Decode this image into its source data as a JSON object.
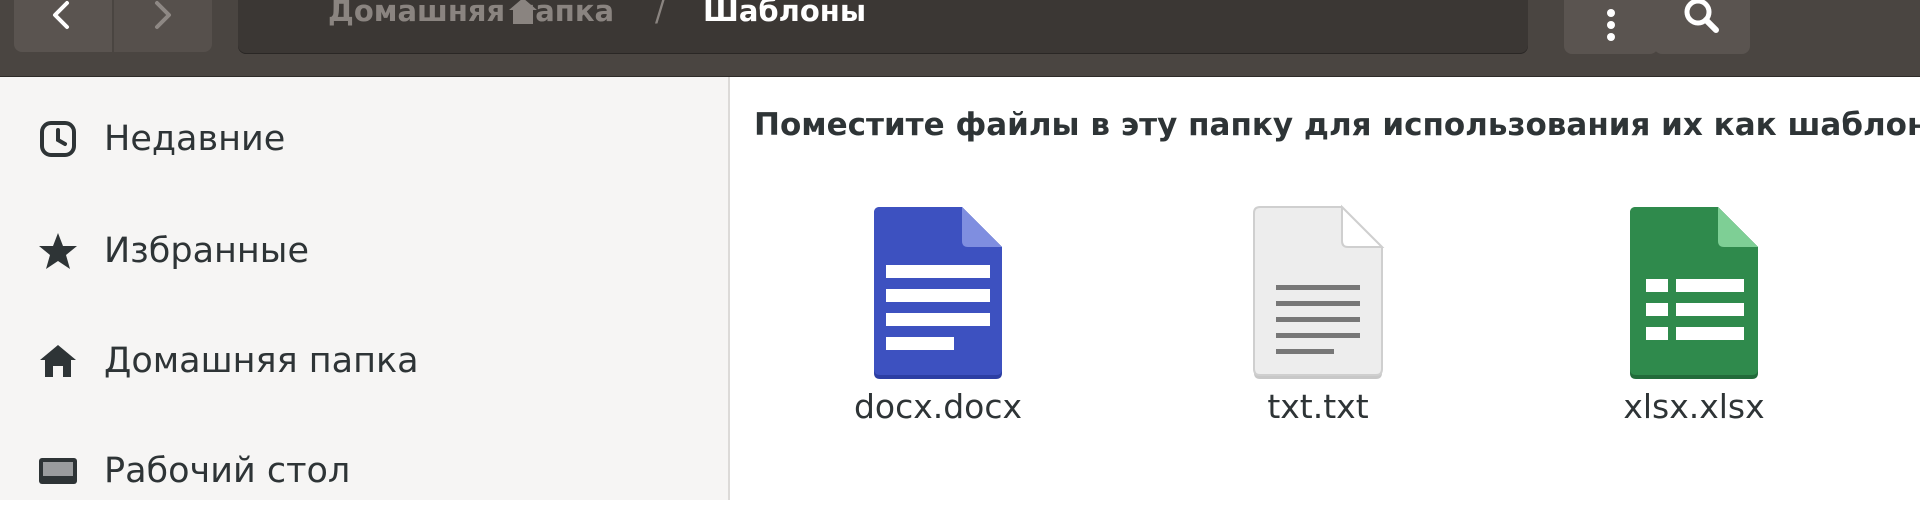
{
  "header": {
    "back_icon": "chevron-left-icon",
    "forward_icon": "chevron-right-icon",
    "breadcrumb": {
      "home_label": "Домашняя папка",
      "separator": "/",
      "current_label": "Шаблоны"
    },
    "menu_icon": "vertical-dots-icon",
    "search_icon": "search-icon"
  },
  "sidebar": {
    "items": [
      {
        "label": "Недавние",
        "icon": "clock-icon"
      },
      {
        "label": "Избранные",
        "icon": "star-icon"
      },
      {
        "label": "Домашняя папка",
        "icon": "home-icon"
      },
      {
        "label": "Рабочий стол",
        "icon": "desktop-icon"
      }
    ]
  },
  "main": {
    "hint_text": "Поместите файлы в эту папку для использования их как шаблон",
    "files": [
      {
        "name": "docx.docx",
        "icon": "document-icon",
        "color": "#3b4fb8"
      },
      {
        "name": "txt.txt",
        "icon": "text-file-icon",
        "color": "#e6e6e6"
      },
      {
        "name": "xlsx.xlsx",
        "icon": "spreadsheet-icon",
        "color": "#2f8a4c"
      }
    ]
  },
  "colors": {
    "headerbar": "#4a4541",
    "sidebar_bg": "#f6f5f4",
    "text": "#2e3436"
  }
}
